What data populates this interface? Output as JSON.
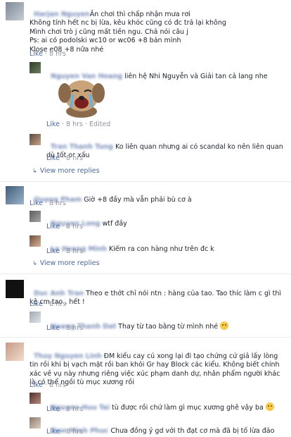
{
  "comments": [
    {
      "author": "Harjan Nguyen",
      "text": "Ăn chơi thì chấp nhận mưa rơi\nKhông tính hết nc bị lừa, kêu khóc cũng có đc trả lại không\nMình chơi trò j cũng mất tiền ngu. Chả nói câu j\nPs: ai có podolski wc10 or wc06 +8 bán mình\nKlose e08 +8 nữa nhé",
      "like": "Like",
      "time": "8 hrs",
      "replies": [
        {
          "author": "Nguyen Van Hoang",
          "text": "liên hệ Nhi Nguyễn và Giải tan cả lang nhe",
          "like": "Like",
          "time": "8 hrs",
          "edited": "Edited",
          "sticker": "crying-dog-sticker"
        },
        {
          "author": "Tran Thanh Tung",
          "text": "Ko liên quan nhưng ai có scandal ko nên liên quan dù tốt or xấu",
          "like": "Like",
          "time": "8 hrs"
        }
      ],
      "view_more": "View more replies"
    },
    {
      "author": "Quang Pham",
      "text": "Giờ +8 đầy mà vẫn phải bù cơ à",
      "like": "Like",
      "time": "8 hrs",
      "replies": [
        {
          "author": "Nguyen Long",
          "text": "wtf đầy",
          "like": "Like",
          "time": "8 hrs"
        },
        {
          "author": "Le Hoang Minh",
          "text": "Kiếm ra con hàng như trên đc k",
          "like": "Like",
          "time": "8 hrs"
        }
      ],
      "view_more": "View more replies"
    },
    {
      "author": "Duc Anh Tran",
      "text": "Theo e thớt chỉ nói ntn : hàng của tao. Tao thíc làm c gì thì kệ cm tao , hết !",
      "like": "Like",
      "time": "8 hrs",
      "replies": [
        {
          "author": "Hoang Thanh Dat",
          "text": "Thay từ tao bằng từ mình nhé",
          "like": "Like",
          "time": "8 hrs",
          "emoji": "smile-emoji"
        }
      ]
    },
    {
      "author": "Thuy Nguyen Linh",
      "text": "ĐM kiểu cay cú xong lại đi tạo chứng cứ giả lấy lòng tin rồi khi bị vạch mặt rồi ban khỏi Gr hay Block các kiểu. Không biết chính xác về vụ này nhưng riêng việc xúc phạm danh dự, nhân phẩm người khác là có thể ngồi tù mục xương rồi",
      "like": "Like",
      "time": "8 hrs",
      "replies": [
        {
          "author": "Nguyen Huu Tai",
          "text": "tù được rồi chứ làm gì mục xương ghê vậy ba",
          "like": "Like",
          "time": "8 hrs",
          "emoji": "grin-emoji"
        },
        {
          "author": "Tran Minh Phuc",
          "text": "Chưa đồng ý gd với th đạt cơ mà đã bị tố lừa đảo",
          "like": "Like",
          "time": "8 hrs"
        }
      ]
    }
  ],
  "separators": ""
}
